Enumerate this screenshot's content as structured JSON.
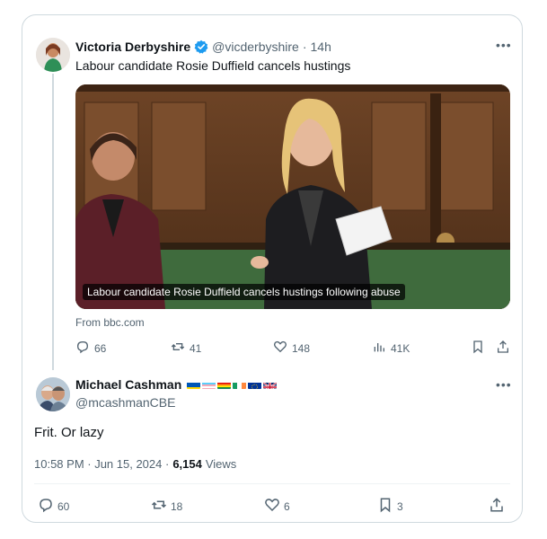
{
  "parent_tweet": {
    "author_name": "Victoria Derbyshire",
    "handle": "@vicderbyshire",
    "separator": "·",
    "time": "14h",
    "text": "Labour candidate Rosie Duffield cancels hustings",
    "media_caption": "Labour candidate Rosie Duffield cancels hustings following abuse",
    "source": "From bbc.com",
    "stats": {
      "replies": "66",
      "reposts": "41",
      "likes": "148",
      "views": "41K"
    },
    "icons": [
      "reply-icon",
      "repost-icon",
      "like-icon",
      "views-icon",
      "bookmark-icon",
      "share-icon"
    ]
  },
  "reply_tweet": {
    "author_name": "Michael Cashman",
    "flags": [
      "ukraine-flag-icon",
      "trans-flag-icon",
      "pride-flag-icon",
      "ireland-flag-icon",
      "eu-flag-icon",
      "uk-flag-icon"
    ],
    "handle": "@mcashmanCBE",
    "text": "Frit. Or lazy",
    "timestamp": "10:58 PM · Jun 15, 2024 ·",
    "views_count": "6,154",
    "views_label": "Views",
    "stats": {
      "replies": "60",
      "reposts": "18",
      "likes": "6",
      "bookmarks": "3"
    }
  },
  "colors": {
    "verified": "#1d9bf0",
    "secondary_text": "#536471",
    "border": "#cfd9de"
  }
}
